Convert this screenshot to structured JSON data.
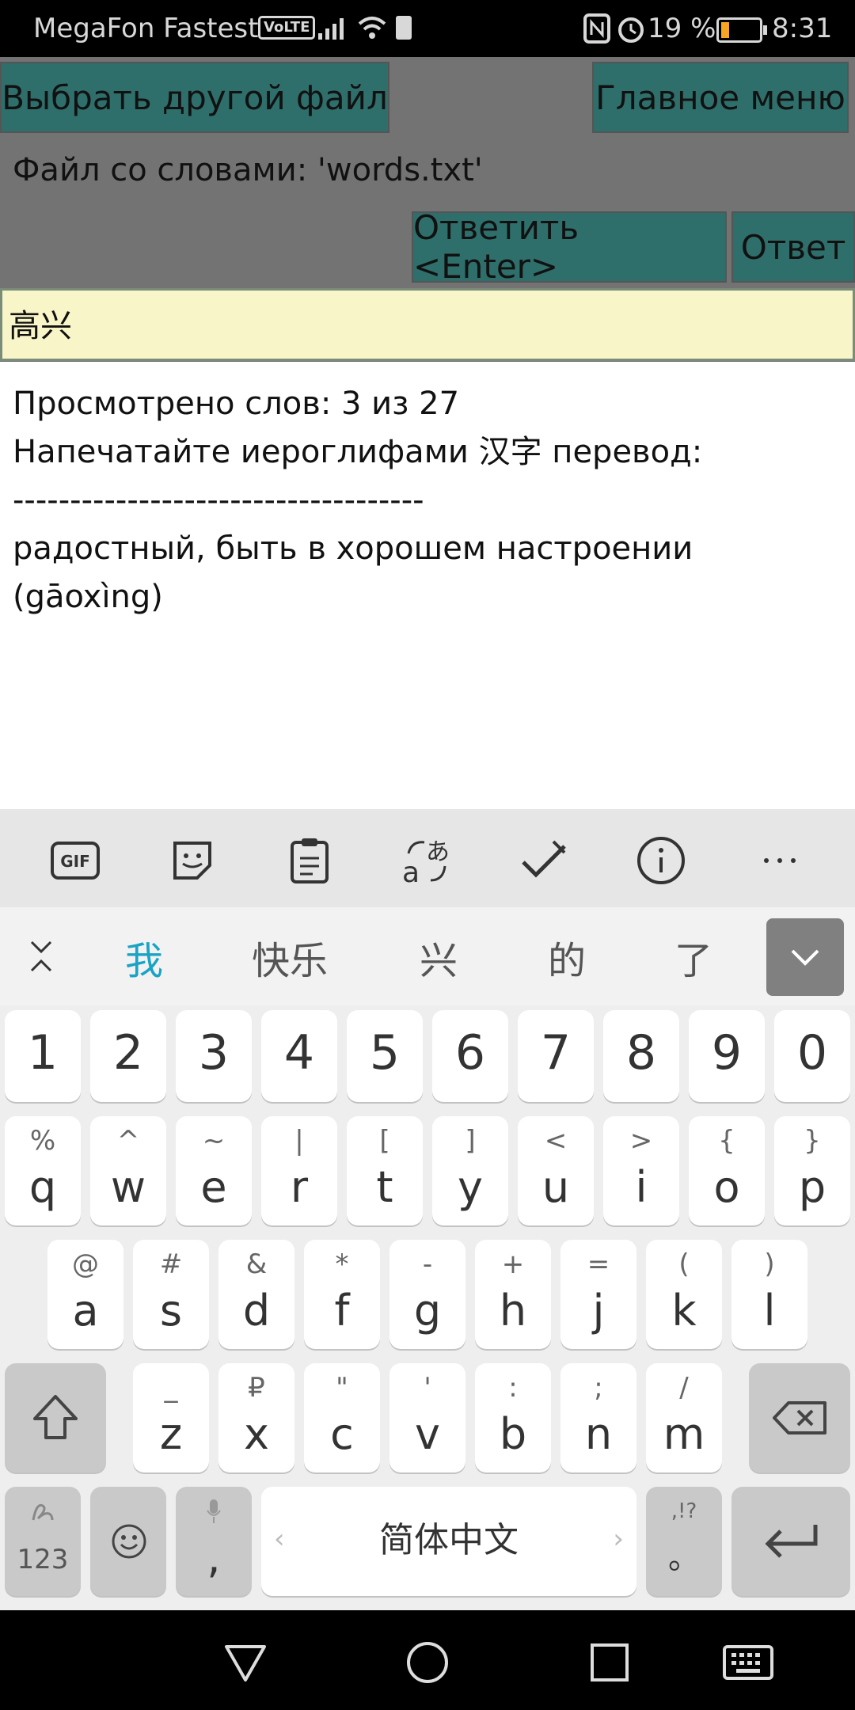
{
  "status_bar": {
    "carrier": "MegaFon Fastest",
    "volte": "VoLTE",
    "battery_percent": "19 %",
    "battery_level": 0.19,
    "time": "8:31"
  },
  "app": {
    "choose_file_label": "Выбрать другой файл",
    "main_menu_label": "Главное меню",
    "file_label": "Файл со словами: 'words.txt'",
    "answer_enter_label": "Ответить <Enter>",
    "answer_label": "Ответ",
    "input_value": "高兴",
    "progress_text": "Просмотрено слов: 3 из 27",
    "instruction": "Напечатайте иероглифами 汉字 перевод:",
    "divider": "------------------------------------",
    "translation": "радостный, быть в хорошем настроении",
    "pinyin": "(gāoxìng)"
  },
  "keyboard": {
    "toolbar_icons": [
      "gif-icon",
      "sticker-icon",
      "clipboard-icon",
      "translate-icon",
      "handwriting-icon",
      "info-icon",
      "more-icon"
    ],
    "gif_label": "GIF",
    "candidates": [
      "我",
      "快乐",
      "兴",
      "的",
      "了"
    ],
    "number_row": [
      "1",
      "2",
      "3",
      "4",
      "5",
      "6",
      "7",
      "8",
      "9",
      "0"
    ],
    "row1": [
      {
        "main": "q",
        "sec": "%"
      },
      {
        "main": "w",
        "sec": "^"
      },
      {
        "main": "e",
        "sec": "~"
      },
      {
        "main": "r",
        "sec": "|"
      },
      {
        "main": "t",
        "sec": "["
      },
      {
        "main": "y",
        "sec": "]"
      },
      {
        "main": "u",
        "sec": "<"
      },
      {
        "main": "i",
        "sec": ">"
      },
      {
        "main": "o",
        "sec": "{"
      },
      {
        "main": "p",
        "sec": "}"
      }
    ],
    "row2": [
      {
        "main": "a",
        "sec": "@"
      },
      {
        "main": "s",
        "sec": "#"
      },
      {
        "main": "d",
        "sec": "&"
      },
      {
        "main": "f",
        "sec": "*"
      },
      {
        "main": "g",
        "sec": "-"
      },
      {
        "main": "h",
        "sec": "+"
      },
      {
        "main": "j",
        "sec": "="
      },
      {
        "main": "k",
        "sec": "("
      },
      {
        "main": "l",
        "sec": ")"
      }
    ],
    "row3": [
      {
        "main": "z",
        "sec": "_"
      },
      {
        "main": "x",
        "sec": "₽"
      },
      {
        "main": "c",
        "sec": "\""
      },
      {
        "main": "v",
        "sec": "'"
      },
      {
        "main": "b",
        "sec": ":"
      },
      {
        "main": "n",
        "sec": ";"
      },
      {
        "main": "m",
        "sec": "/"
      }
    ],
    "symbols_label": "123",
    "comma": ",",
    "space_label": "简体中文",
    "punct_sec": ",!?",
    "punct_main": "。"
  }
}
